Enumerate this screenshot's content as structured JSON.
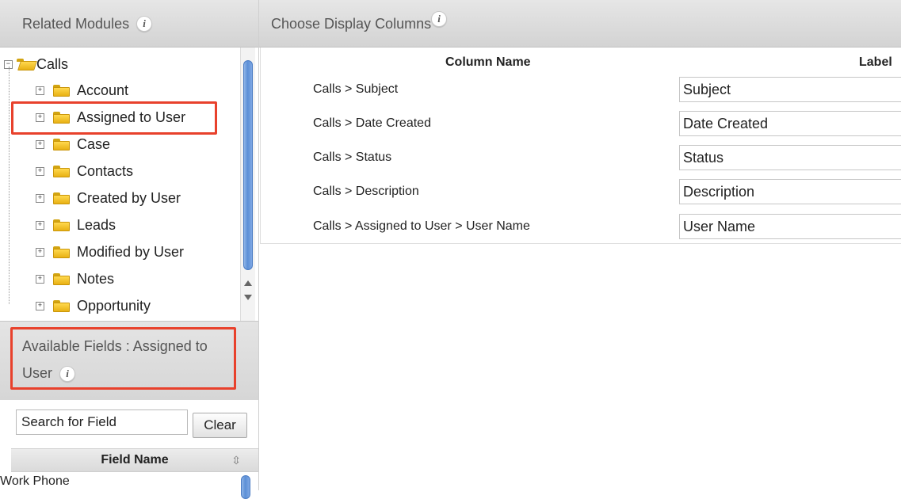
{
  "left_panel": {
    "related_modules_title": "Related Modules",
    "info_symbol": "i",
    "tree": {
      "root": {
        "label": "Calls",
        "expander": "−",
        "icon": "open-folder-icon"
      },
      "children": [
        {
          "label": "Account",
          "expander": "+"
        },
        {
          "label": "Assigned to User",
          "expander": "+",
          "highlighted": true
        },
        {
          "label": "Case",
          "expander": "+"
        },
        {
          "label": "Contacts",
          "expander": "+"
        },
        {
          "label": "Created by User",
          "expander": "+"
        },
        {
          "label": "Leads",
          "expander": "+"
        },
        {
          "label": "Modified by User",
          "expander": "+"
        },
        {
          "label": "Notes",
          "expander": "+"
        },
        {
          "label": "Opportunity",
          "expander": "+"
        }
      ]
    },
    "available_fields_title": "Available Fields : Assigned to User",
    "search": {
      "value": "Search for Field",
      "clear_label": "Clear"
    },
    "field_list": {
      "header": "Field Name",
      "sort_icon": "sort-arrows-icon",
      "rows": [
        "Work Phone"
      ]
    }
  },
  "right_panel": {
    "title": "Choose Display Columns",
    "headers": {
      "column_name": "Column Name",
      "label": "Label"
    },
    "rows": [
      {
        "column": "Calls > Subject",
        "label": "Subject"
      },
      {
        "column": "Calls > Date Created",
        "label": "Date Created"
      },
      {
        "column": "Calls > Status",
        "label": "Status"
      },
      {
        "column": "Calls > Description",
        "label": "Description"
      },
      {
        "column": "Calls > Assigned to User > User Name",
        "label": "User Name"
      }
    ]
  },
  "colors": {
    "highlight_border": "#e8412c",
    "header_bg": "#d9d9d9",
    "folder_yellow": "#f2c230",
    "scroll_thumb_blue": "#5b8fd6"
  }
}
